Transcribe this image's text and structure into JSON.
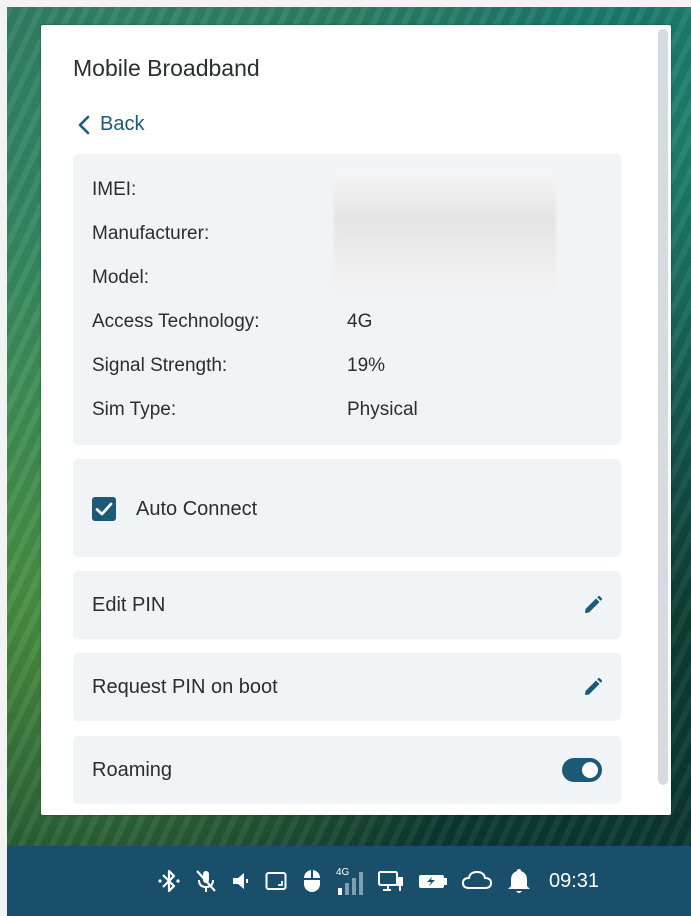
{
  "panel": {
    "title": "Mobile Broadband",
    "back_label": "Back"
  },
  "device_info": {
    "imei_label": "IMEI:",
    "manufacturer_label": "Manufacturer:",
    "model_label": "Model:",
    "access_technology_label": "Access Technology:",
    "access_technology_value": "4G",
    "signal_strength_label": "Signal Strength:",
    "signal_strength_value": "19%",
    "sim_type_label": "Sim Type:",
    "sim_type_value": "Physical"
  },
  "auto_connect": {
    "label": "Auto Connect",
    "checked": true
  },
  "options": {
    "edit_pin_label": "Edit PIN",
    "request_pin_label": "Request PIN on boot",
    "roaming_label": "Roaming",
    "roaming_enabled": true
  },
  "taskbar": {
    "network_badge": "4G",
    "clock": "09:31",
    "icons": [
      "bluetooth-icon",
      "mic-muted-icon",
      "volume-icon",
      "screen-icon",
      "mouse-icon",
      "signal-icon",
      "display-network-icon",
      "battery-icon",
      "cloud-icon",
      "notification-bell-icon"
    ]
  },
  "colors": {
    "accent": "#1c5a78",
    "taskbar": "#194f6a",
    "card": "#f0f4f6"
  }
}
